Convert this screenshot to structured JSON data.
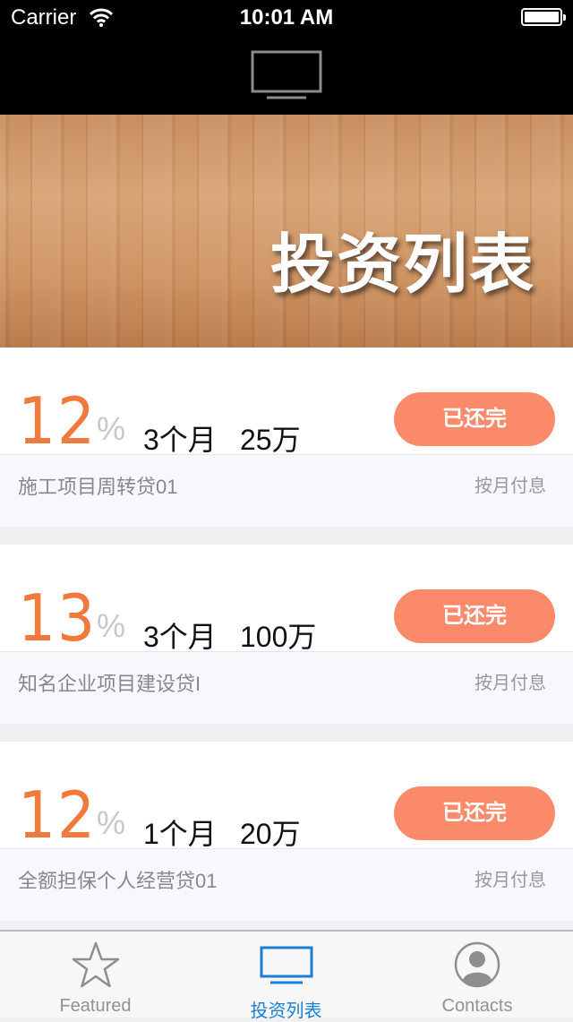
{
  "status_bar": {
    "carrier": "Carrier",
    "time": "10:01 AM"
  },
  "nav": {
    "icon": "tv-icon"
  },
  "banner": {
    "title": "投资列表"
  },
  "items": [
    {
      "rate": "12",
      "percent": "%",
      "term": "3个月",
      "amount": "25万",
      "status": "已还完",
      "name": "施工项目周转贷01",
      "repayment": "按月付息"
    },
    {
      "rate": "13",
      "percent": "%",
      "term": "3个月",
      "amount": "100万",
      "status": "已还完",
      "name": "知名企业项目建设贷I",
      "repayment": "按月付息"
    },
    {
      "rate": "12",
      "percent": "%",
      "term": "1个月",
      "amount": "20万",
      "status": "已还完",
      "name": "全额担保个人经营贷01",
      "repayment": "按月付息"
    }
  ],
  "tabbar": {
    "tabs": [
      {
        "label": "Featured",
        "icon": "star-icon",
        "active": false
      },
      {
        "label": "投资列表",
        "icon": "tv-icon",
        "active": true
      },
      {
        "label": "Contacts",
        "icon": "person-icon",
        "active": false
      }
    ]
  },
  "colors": {
    "rate": "#f07a3e",
    "status_button": "#fb8a6a",
    "active_tab": "#1a7fd6"
  }
}
